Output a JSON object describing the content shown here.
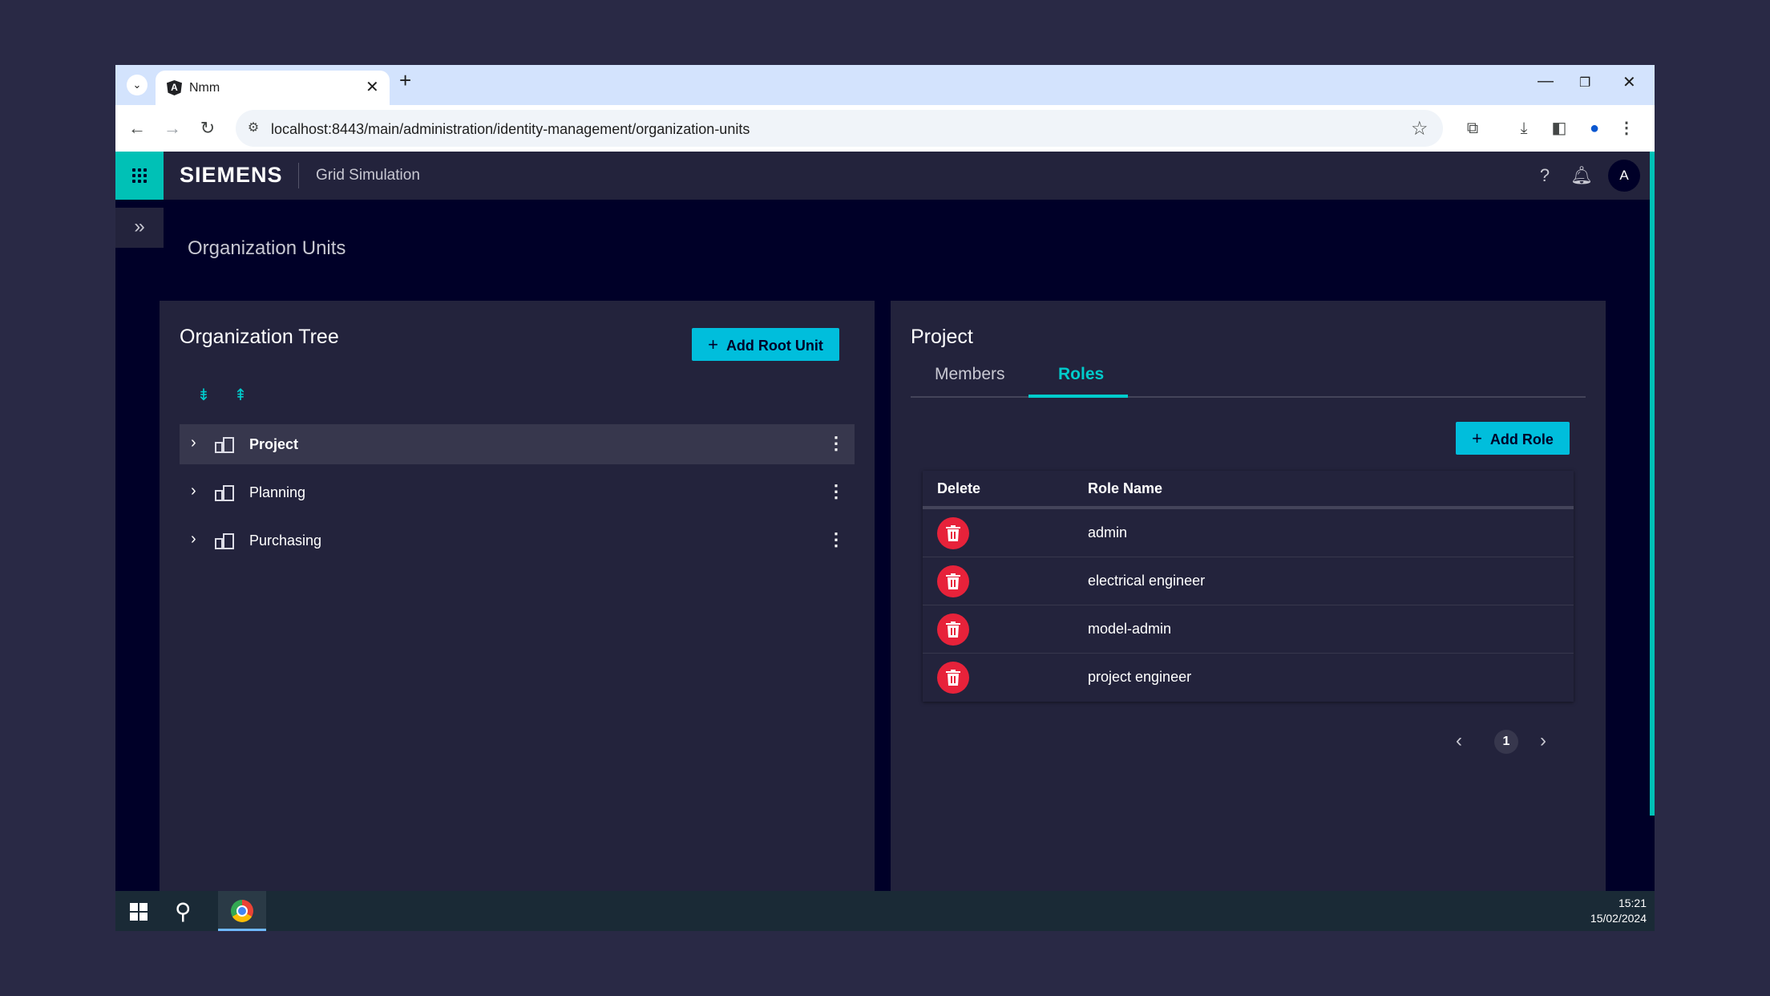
{
  "browser": {
    "tab_title": "Nmm",
    "tab_close": "✕",
    "new_tab": "+",
    "url": "localhost:8443/main/administration/identity-management/organization-units",
    "window_controls": {
      "minimize": "—",
      "restore": "❐",
      "close": "✕"
    }
  },
  "app": {
    "brand": "SIEMENS",
    "name": "Grid Simulation",
    "avatar_initial": "A",
    "page_title": "Organization Units"
  },
  "left_panel": {
    "title": "Organization Tree",
    "add_button": "Add Root Unit",
    "tree": [
      {
        "label": "Project",
        "selected": true
      },
      {
        "label": "Planning",
        "selected": false
      },
      {
        "label": "Purchasing",
        "selected": false
      }
    ]
  },
  "right_panel": {
    "title": "Project",
    "tabs": {
      "members": "Members",
      "roles": "Roles"
    },
    "active_tab": "Roles",
    "add_button": "Add Role",
    "columns": {
      "delete": "Delete",
      "role_name": "Role Name"
    },
    "roles": [
      "admin",
      "electrical engineer",
      "model-admin",
      "project engineer"
    ],
    "pagination": {
      "current_page": "1"
    }
  },
  "taskbar": {
    "time": "15:21",
    "date": "15/02/2024"
  },
  "colors": {
    "accent": "#00c1b6",
    "primary_button": "#00bedc",
    "danger": "#e7223a",
    "background": "#000028",
    "panel": "#23233c"
  },
  "icons": [
    "chevron-down-icon",
    "angular-icon",
    "back-icon",
    "forward-icon",
    "reload-icon",
    "star-icon",
    "extensions-icon",
    "download-icon",
    "sidepanel-icon",
    "profile-icon",
    "kebab-icon",
    "app-launcher-icon",
    "help-icon",
    "bell-icon",
    "double-chevron-right-icon",
    "expand-all-icon",
    "collapse-all-icon",
    "building-icon",
    "trash-icon",
    "windows-start-icon",
    "search-icon",
    "chrome-icon"
  ]
}
